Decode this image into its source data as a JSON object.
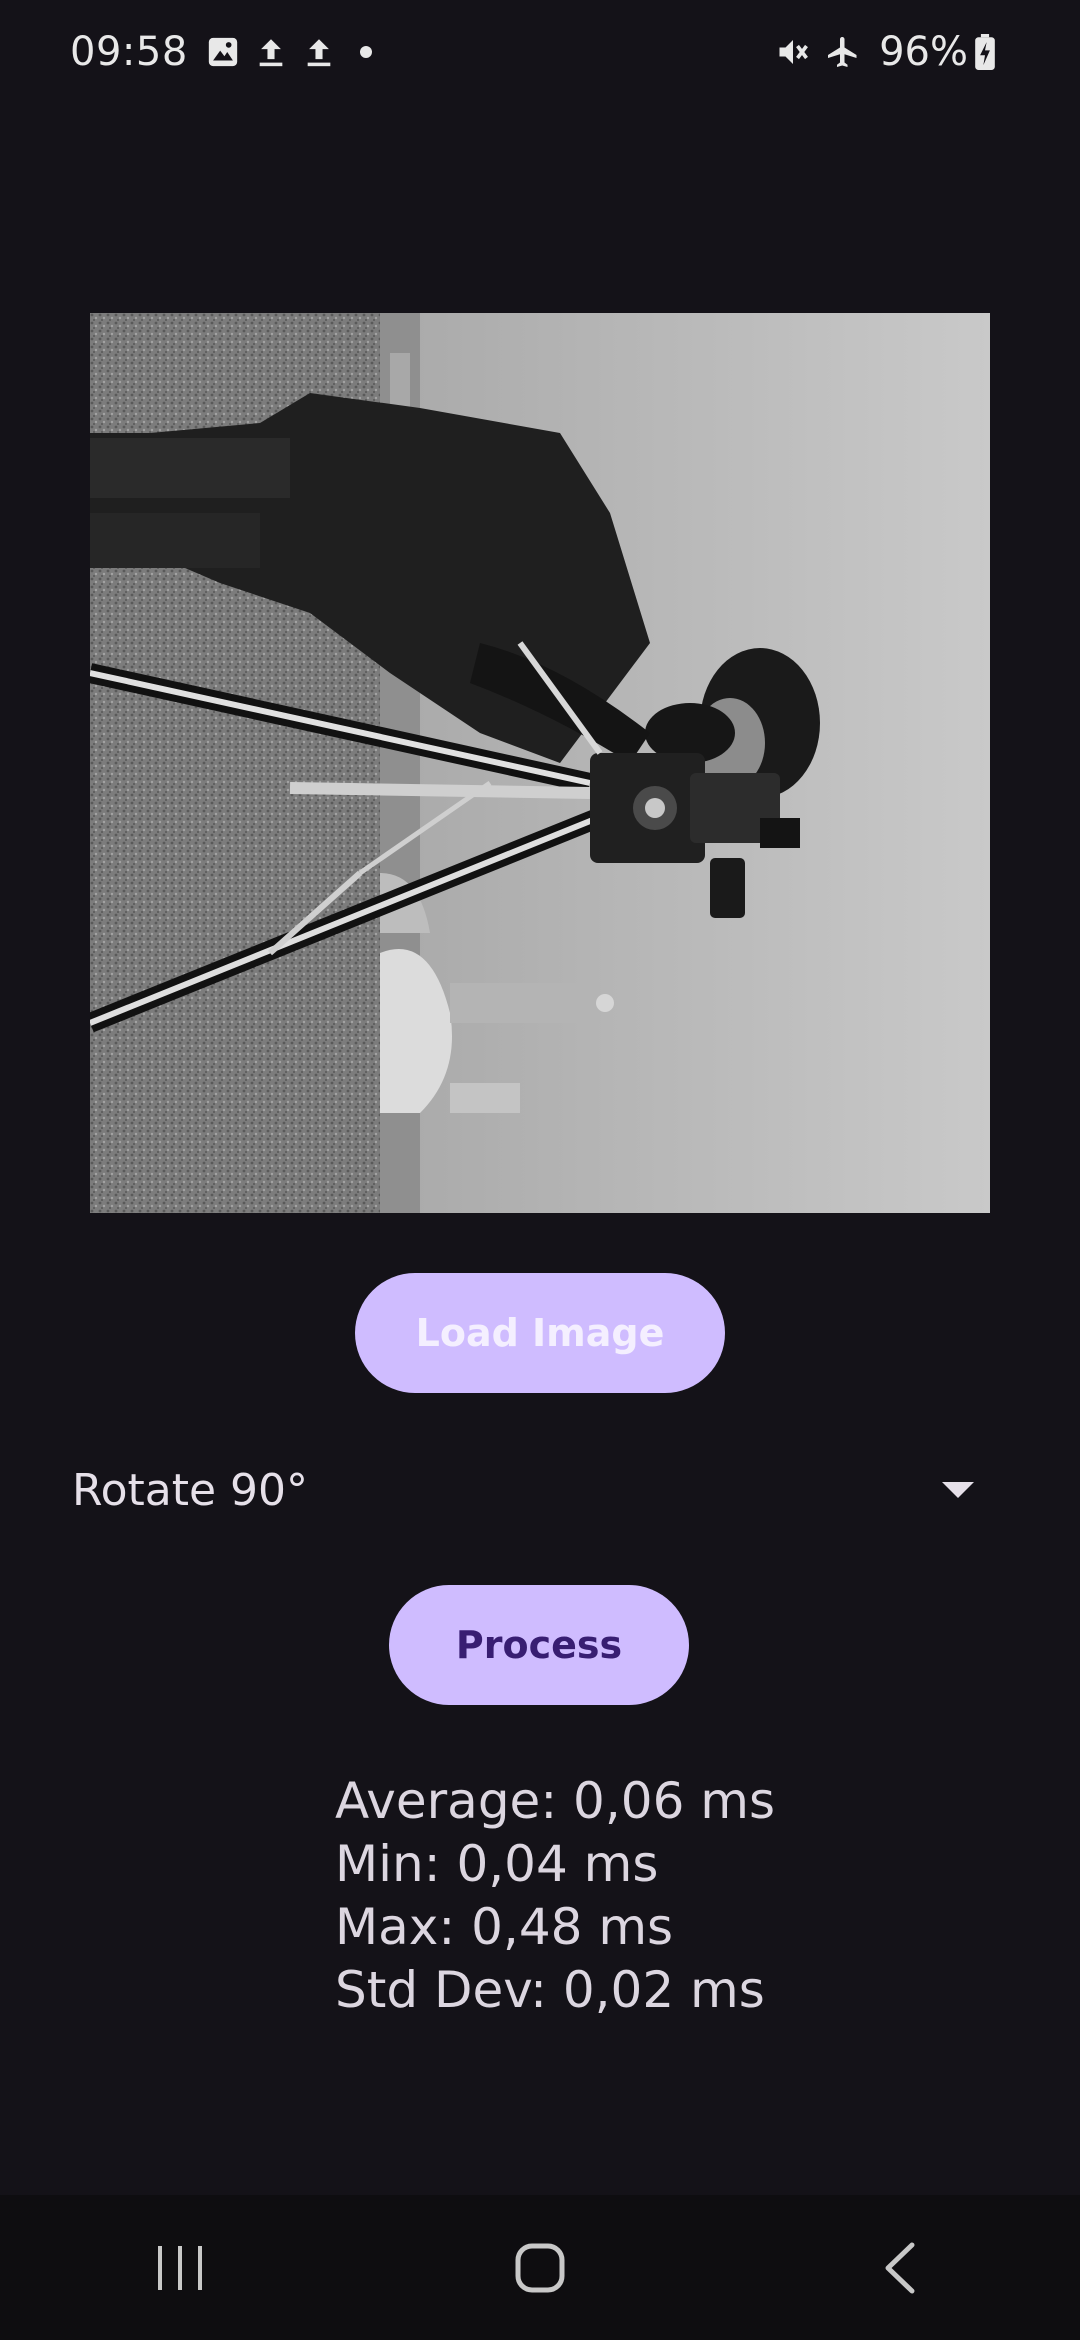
{
  "status_bar": {
    "time": "09:58",
    "battery": "96%",
    "icons": [
      "gallery-icon",
      "upload-icon",
      "upload-icon",
      "notification-dot",
      "mute-icon",
      "airplane-icon",
      "battery-charging-icon"
    ]
  },
  "main": {
    "load_button": "Load Image",
    "operation": {
      "selected": "Rotate 90°"
    },
    "process_button": "Process",
    "stats": {
      "average": "Average: 0,06 ms",
      "min": "Min: 0,04 ms",
      "max": "Max: 0,48 ms",
      "std_dev": "Std Dev: 0,02 ms"
    }
  },
  "nav_bar": {
    "icons": [
      "recents-icon",
      "home-icon",
      "back-icon"
    ]
  },
  "colors": {
    "background": "#141218",
    "button": "#cfbcff",
    "button_text_dark": "#381e72",
    "nav_bar": "#0e0d10"
  }
}
